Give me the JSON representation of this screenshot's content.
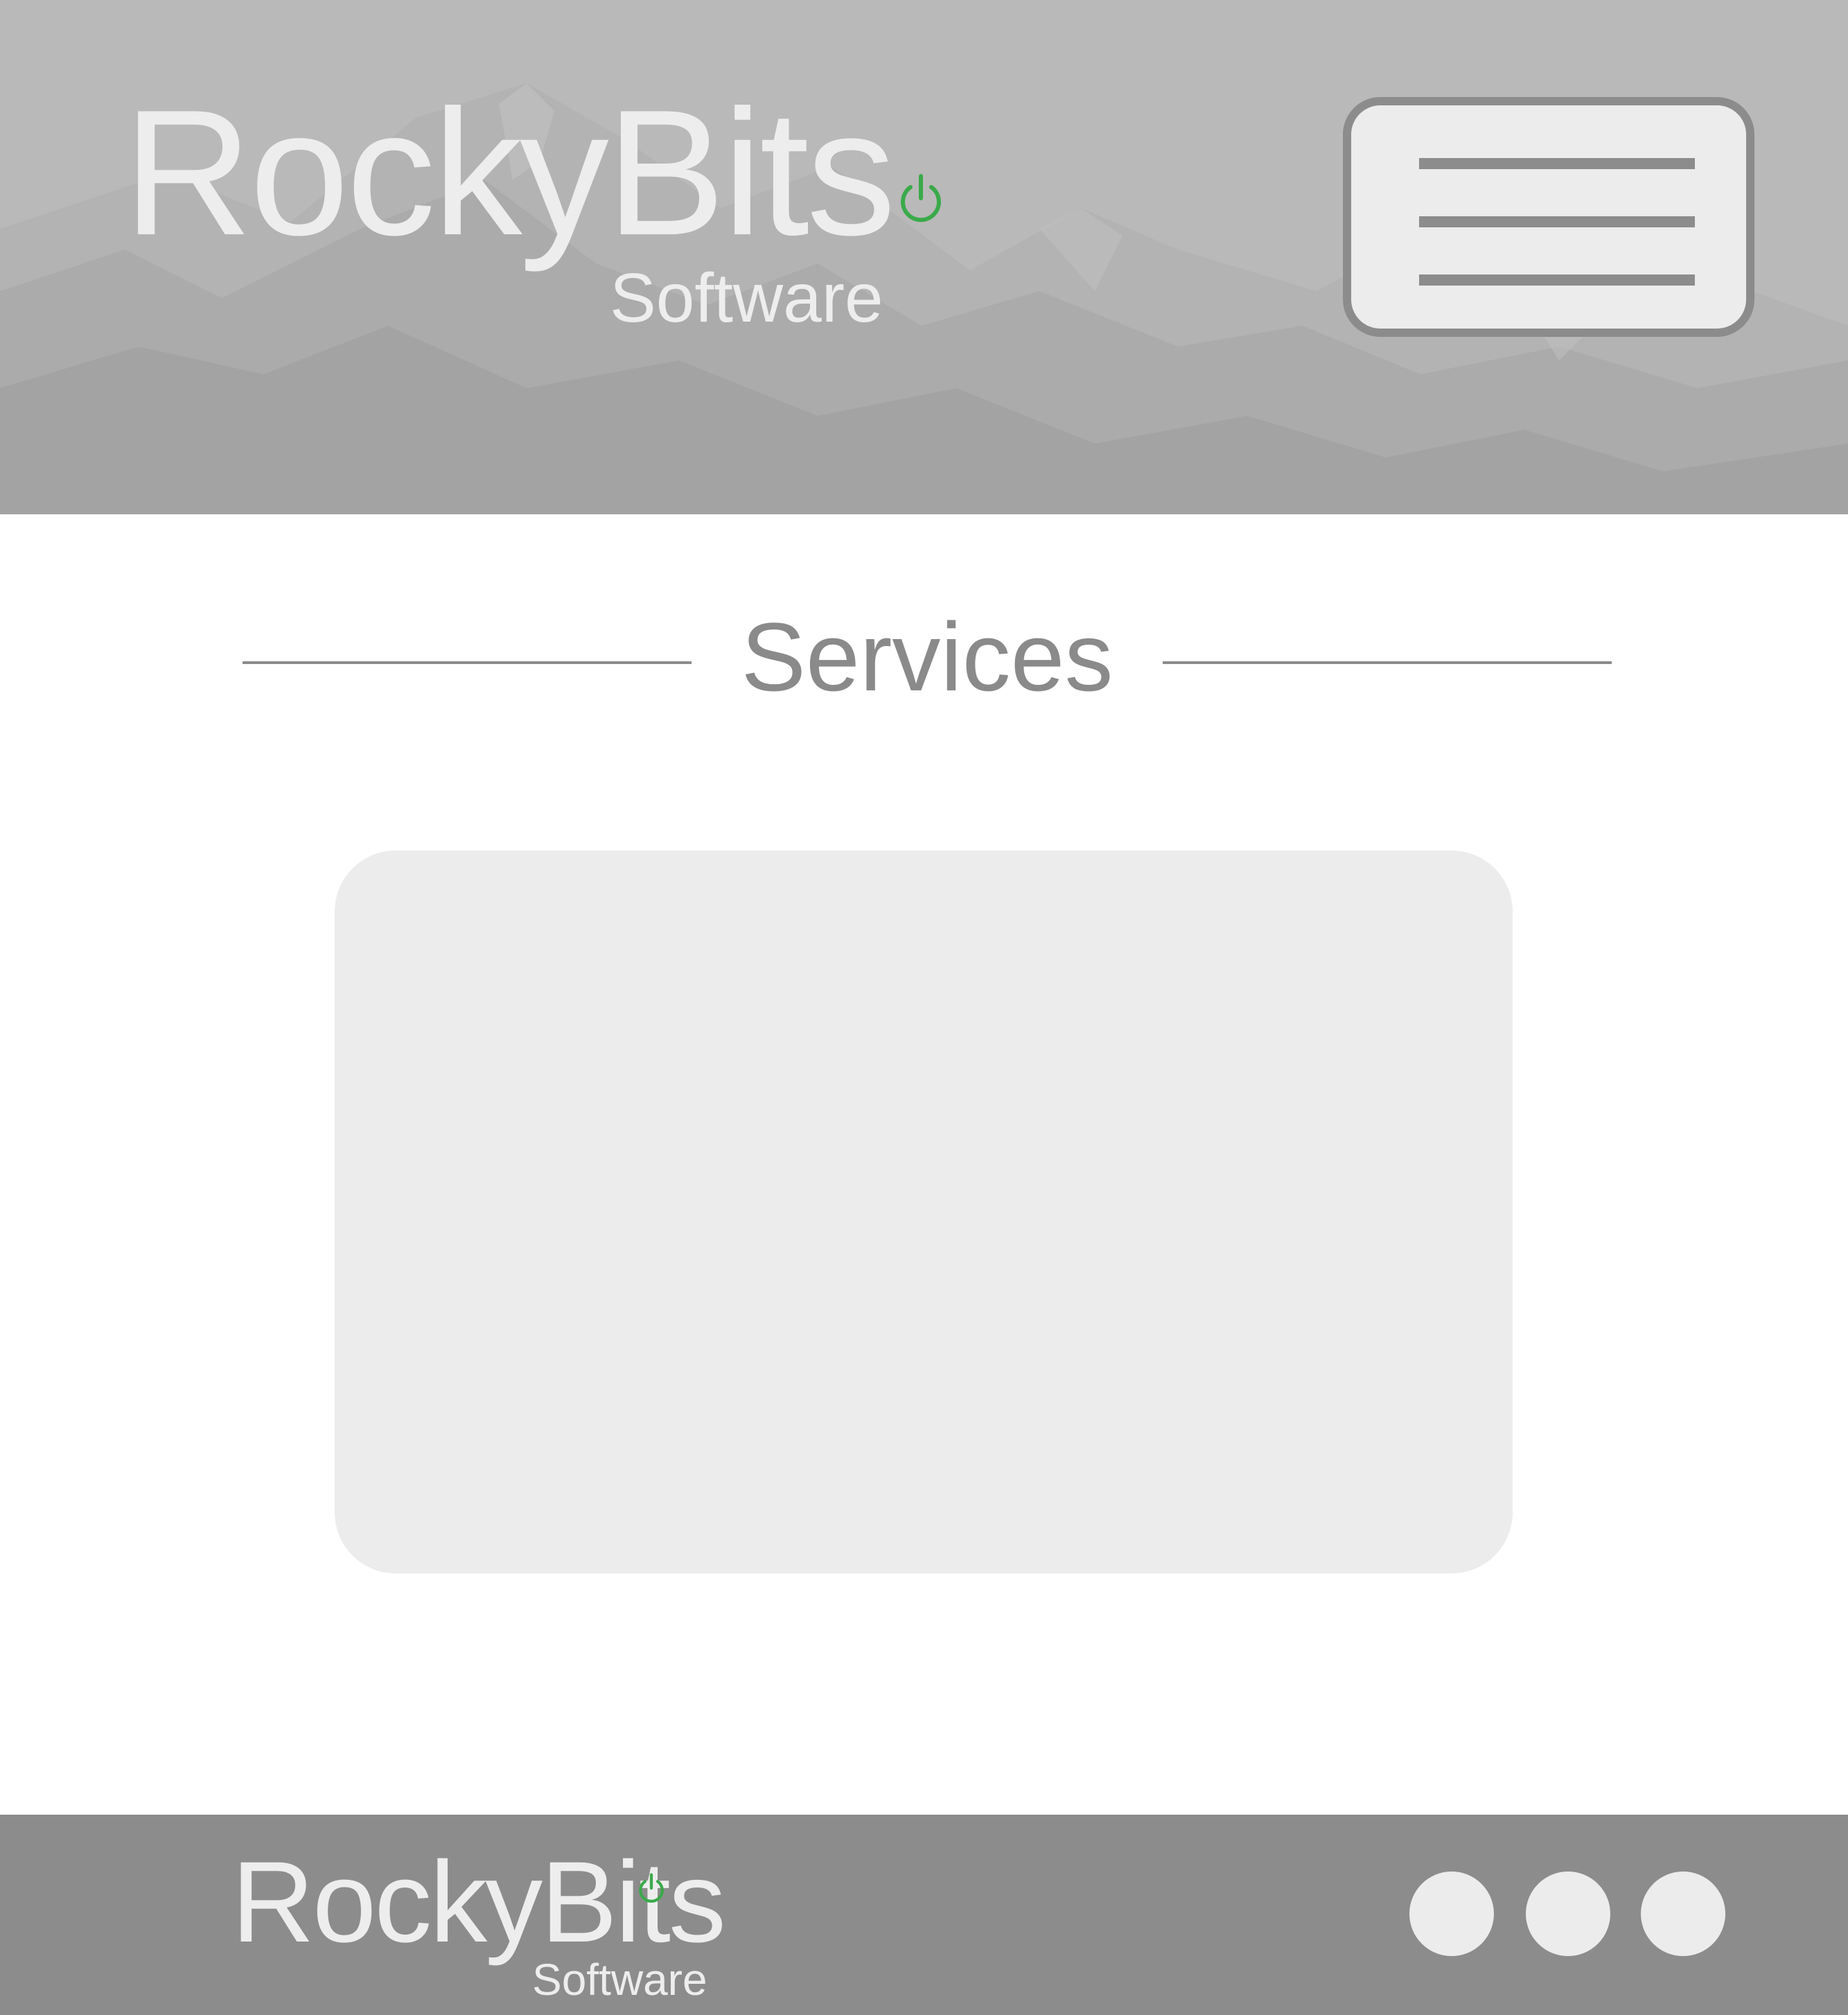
{
  "header": {
    "logo": {
      "name": "RockyBits",
      "sub": "Software",
      "icon": "power-icon",
      "icon_color": "#3aaa4a"
    },
    "menu_button": {
      "icon": "hamburger-menu-icon"
    },
    "background_color": "#b9b9b9"
  },
  "main": {
    "section_title": "Services",
    "card": {
      "color": "#ececec"
    }
  },
  "footer": {
    "logo": {
      "name": "RockyBits",
      "sub": "Software",
      "icon": "power-icon",
      "icon_color": "#3aaa4a"
    },
    "social_links": [
      {
        "icon": "circle-icon"
      },
      {
        "icon": "circle-icon"
      },
      {
        "icon": "circle-icon"
      }
    ],
    "background_color": "#8c8c8c"
  }
}
